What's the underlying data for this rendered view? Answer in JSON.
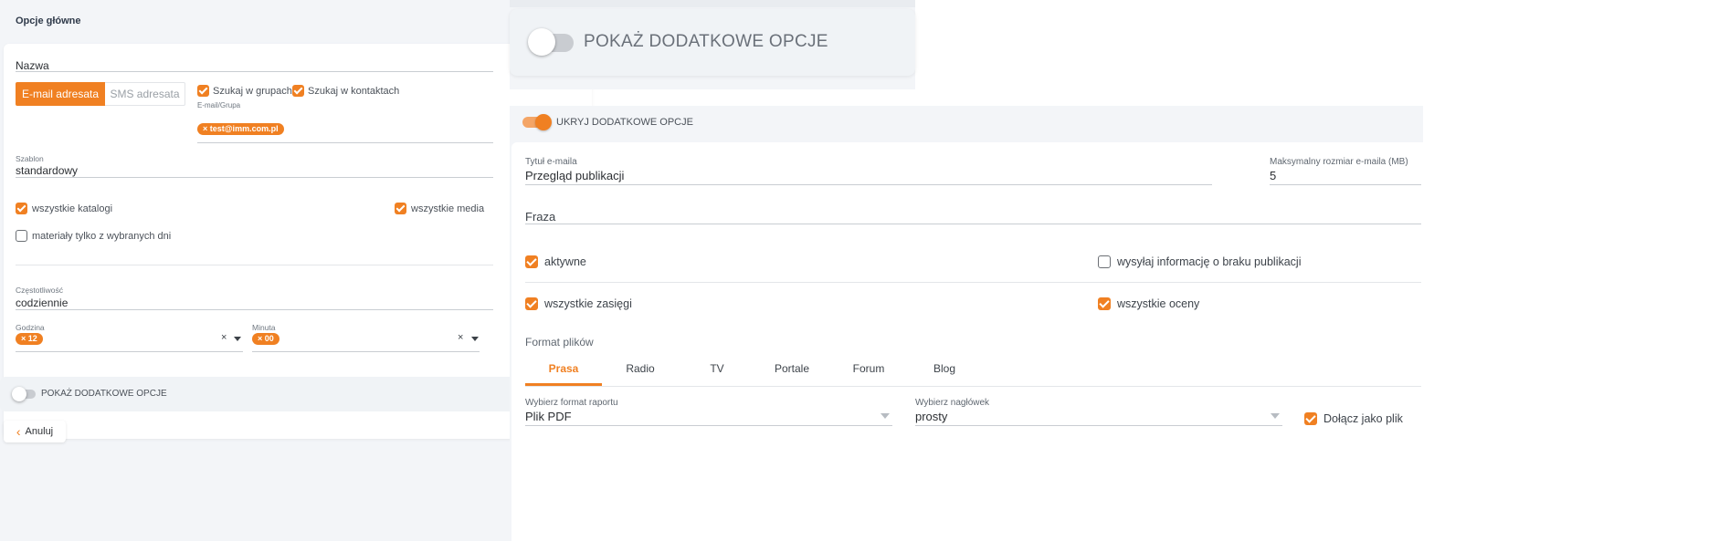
{
  "panel_a": {
    "header_title": "Opcje główne",
    "nazwa": {
      "label": "Nazwa",
      "value": ""
    },
    "recipient_type": {
      "email_label": "E-mail adresata",
      "sms_label": "SMS adresata",
      "selected": "E-mail adresata"
    },
    "search_groups_label": "Szukaj w grupach",
    "search_contacts_label": "Szukaj w kontaktach",
    "email_group_label": "E-mail/Grupa",
    "email_chip": "test@imm.com.pl",
    "szablon": {
      "label": "Szablon",
      "value": "standardowy"
    },
    "all_catalogs_label": "wszystkie katalogi",
    "all_media_label": "wszystkie media",
    "selected_days_label": "materiały tylko z wybranych dni",
    "czestotliwosc": {
      "label": "Częstotliwość",
      "value": "codziennie"
    },
    "godzina": {
      "label": "Godzina",
      "chip": "12"
    },
    "minuta": {
      "label": "Minuta",
      "chip": "00"
    },
    "chip_remove": "×",
    "clear_glyph": "×",
    "show_more_label": "POKAŻ DODATKOWE OPCJE",
    "cancel_label": "Anuluj",
    "back_glyph": "‹"
  },
  "panel_b": {
    "show_more_label": "POKAŻ DODATKOWE OPCJE"
  },
  "panel_c": {
    "hide_more_label": "UKRYJ DODATKOWE OPCJE",
    "email_title": {
      "label": "Tytuł e-maila",
      "value": "Przegląd publikacji"
    },
    "max_size": {
      "label": "Maksymalny rozmiar e-maila (MB)",
      "value": "5"
    },
    "fraza": {
      "label": "Fraza",
      "value": ""
    },
    "active_label": "aktywne",
    "no_publication_label": "wysyłaj informację o braku publikacji",
    "all_reach_label": "wszystkie zasięgi",
    "all_ratings_label": "wszystkie oceny",
    "file_format_label": "Format plików",
    "tabs": [
      "Prasa",
      "Radio",
      "TV",
      "Portale",
      "Forum",
      "Blog"
    ],
    "active_tab": "Prasa",
    "report_format": {
      "label": "Wybierz format raportu",
      "value": "Plik PDF"
    },
    "header_select": {
      "label": "Wybierz nagłówek",
      "value": "prosty"
    },
    "attach_as_file_label": "Dołącz jako plik"
  },
  "colors": {
    "accent": "#f08022",
    "background": "#f3f5f8",
    "card": "#ffffff"
  }
}
